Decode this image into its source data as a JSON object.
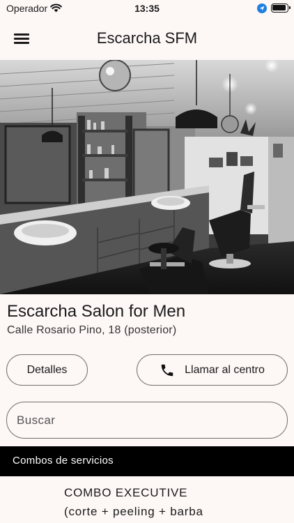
{
  "status_bar": {
    "carrier": "Operador",
    "time": "13:35",
    "icons": [
      "wifi-icon",
      "location-arrow-icon",
      "battery-icon"
    ]
  },
  "app_bar": {
    "menu_icon": "hamburger-menu-icon",
    "title": "Escarcha SFM"
  },
  "hero": {
    "image": "black-and-white photo of barbershop interior"
  },
  "salon": {
    "name": "Escarcha Salon for Men",
    "address": "Calle Rosario Pino, 18 (posterior)"
  },
  "actions": {
    "details_label": "Detalles",
    "call_label": "Llamar al centro",
    "call_icon": "phone-icon"
  },
  "search": {
    "placeholder": "Buscar",
    "value": ""
  },
  "services": {
    "section_title": "Combos de servicios",
    "items": [
      {
        "title": "COMBO EXECUTIVE",
        "description": "(corte + peeling + barba"
      }
    ]
  }
}
